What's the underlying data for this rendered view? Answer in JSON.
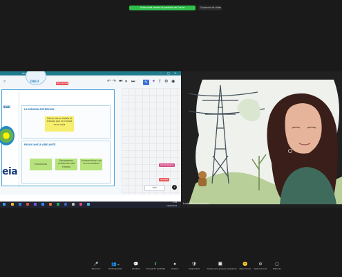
{
  "topbar": {
    "share_label": "Usted está viendo la pantalla de Carlos",
    "view_label": "Opciones de vista"
  },
  "shared": {
    "window_title": "Mural - Canvas",
    "logo_text": "DBLD",
    "red_tag": "Tema del día",
    "strip_label": "IDAD",
    "brand_text": "eia",
    "panel1_title": "LA MÁXIMA EXPRESIÓN",
    "panel1_note": "Cómo hacer visible el trabajo que se realiza en el aula",
    "panel2_title": "PASOS HACIA ADELANTE",
    "panel2_notes": [
      "Evaluamos",
      "Recogemos evidencias del trabajo",
      "Compartimos con la comunidad"
    ],
    "chip1": "Carlos Navarro",
    "chip2": "Ana Ruiz",
    "zoom": "90%",
    "help": "?",
    "tray_time": "9:44",
    "tray_date": "22/05/2024"
  },
  "video": {
    "name": "Lucía Moreno Jiménez"
  },
  "toolbar": {
    "items": [
      {
        "icon": "🎤",
        "label": "Silenciar"
      },
      {
        "icon": "📷",
        "label": "Detener vídeo"
      },
      {
        "icon": "🛡",
        "label": "Seguridad"
      },
      {
        "icon": "👥",
        "label": "Participantes"
      },
      {
        "icon": "💬",
        "label": "Chatear"
      },
      {
        "icon": "⬆",
        "label": "Compartir pantalla"
      },
      {
        "icon": "⏺",
        "label": "Grabar"
      },
      {
        "icon": "🔲",
        "label": "Salas para grupos pequeños"
      },
      {
        "icon": "🙂",
        "label": "Reacciones"
      },
      {
        "icon": "⚙",
        "label": "Aplicaciones"
      },
      {
        "icon": "⋯",
        "label": "Más"
      },
      {
        "icon": "▢",
        "label": "Pizarras"
      }
    ],
    "participants_count": "14"
  },
  "colors": {
    "share_green": "#2fbf4c",
    "panel_border": "#4ba4d8",
    "sticky_yellow": "#f6ee6c",
    "sticky_green": "#b6e37c"
  }
}
